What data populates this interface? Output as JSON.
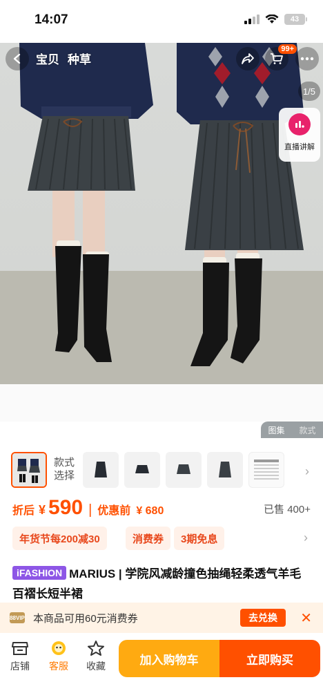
{
  "status_bar": {
    "time": "14:07",
    "battery": "43"
  },
  "top_nav": {
    "tabs": [
      "宝贝",
      "种草"
    ],
    "cart_badge": "99+",
    "pager": "1/5",
    "live_label": "直播讲解"
  },
  "gallery": {
    "toggle": [
      "图集",
      "款式"
    ]
  },
  "variants": {
    "label_line1": "款式",
    "label_line2": "选择",
    "thumb_count": 5
  },
  "price": {
    "discount_label": "折后",
    "currency": "¥",
    "value": "590",
    "separator": "|",
    "original_label": "优惠前",
    "original": "¥ 680",
    "sold": "已售 400+"
  },
  "promos": [
    "年货节每200减30",
    "消费券",
    "3期免息"
  ],
  "title": {
    "brand_tag": "iFASHION",
    "text": "MARIUS | 学院风减龄撞色抽绳轻柔透气羊毛百褶长短半裙"
  },
  "coupon": {
    "icon": "88VIP",
    "text": "本商品可用60元消费券",
    "button": "去兑换"
  },
  "bottom_bar": {
    "store": "店铺",
    "service": "客服",
    "favorite": "收藏",
    "add_to_cart": "加入购物车",
    "buy_now": "立即购买"
  },
  "colors": {
    "accent": "#ff5000",
    "cart_button": "#ffaa11",
    "brand_tag": "#8d56e6"
  }
}
